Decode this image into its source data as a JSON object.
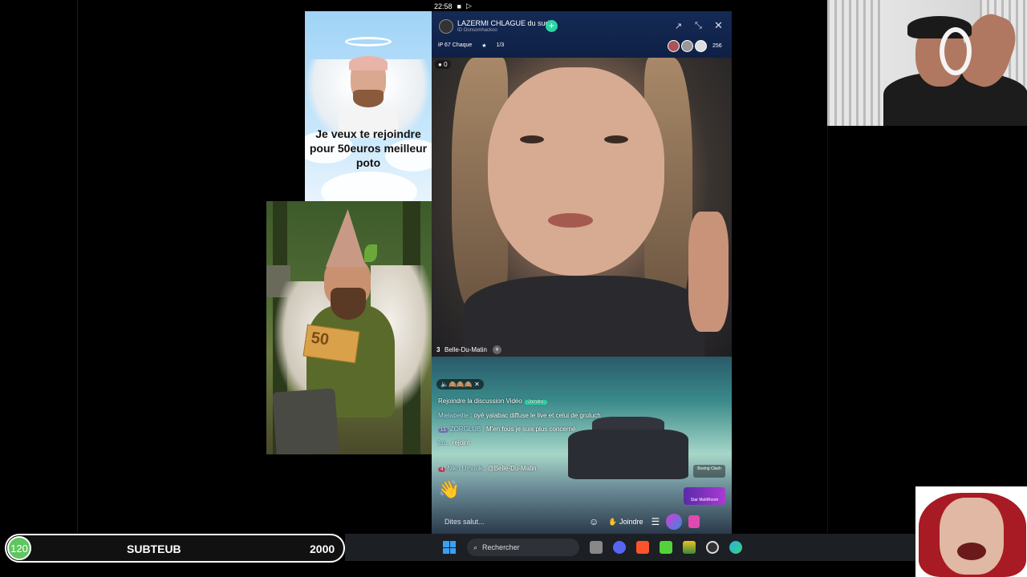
{
  "status_bar": {
    "time": "22:58"
  },
  "meme_top": {
    "caption": "Je veux te rejoindre pour 50euros meilleur poto"
  },
  "meme_bottom": {
    "bill_value": "50"
  },
  "live": {
    "host_name": "LAZERMI CHLAGUE du sud",
    "host_id": "ID Oonsomhackoo",
    "follow_icon": "+",
    "meta": {
      "rank": "iP 67 Chaque",
      "slots": "1/3"
    },
    "viewer_count": "256",
    "coins": "0",
    "guest": {
      "number": "3",
      "name": "Belle-Du-Matin"
    },
    "chat_pill": "🔈🙈🙈🙈 ✕",
    "chat": {
      "join_prompt": "Rejoindre la discussion Vidéo",
      "join_tag": "Joindre",
      "msg1_user": "Mielabeille",
      "msg1_text": " : oyé yalabac diffuse le live et celui de gruluch",
      "msg2_level": "15",
      "msg2_user": "ZORGLUB",
      "msg2_text": " : M'en fous je suis plus concerné",
      "msg3_user": "Lo...",
      "msg3_text": " rejoint",
      "msg4_level": "4",
      "msg4_user": "Niko Umook",
      "msg4_text": " : @Belle-Du-Matin"
    },
    "badges": {
      "boxing": "Boxing Clash",
      "multiroom": "Star MultiRoom"
    },
    "bottom": {
      "say_hi": "Dites salut...",
      "join": "Joindre"
    }
  },
  "goal_bar": {
    "current": "120",
    "label": "SUBTEUB",
    "target": "2000"
  },
  "taskbar": {
    "search_placeholder": "Rechercher"
  },
  "colors": {
    "accent": "#2dd4a4",
    "goal_green": "#5ec65e",
    "taskbar": "#1c1f24"
  }
}
